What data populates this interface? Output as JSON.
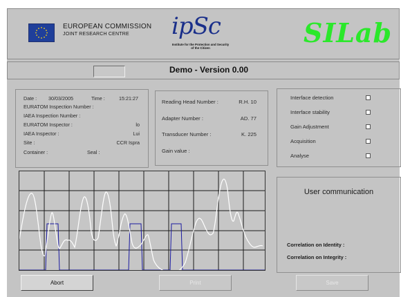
{
  "header": {
    "org_line1": "EUROPEAN COMMISSION",
    "org_line2": "JOINT RESEARCH CENTRE",
    "ipsc_logo": "ipSc",
    "ipsc_subtitle": "Institute for the Protection and Security of the Citizen",
    "app_logo": "SILab"
  },
  "titlebar": {
    "title": "Demo - Version 0.00",
    "field_value": ""
  },
  "inspection": {
    "date_label": "Date :",
    "date_value": "30/03/2005",
    "time_label": "Time :",
    "time_value": "15:21:27",
    "euratom_number_label": "EURATOM Inspection Number :",
    "iaea_number_label": "IAEA Inspection Number :",
    "euratom_inspector_label": "EURATOM Inspector :",
    "euratom_inspector_value": "lo",
    "iaea_inspector_label": "IAEA Inspector :",
    "iaea_inspector_value": "Lui",
    "site_label": "Site :",
    "site_value": "CCR Ispra",
    "container_label": "Container :",
    "seal_label": "Seal :"
  },
  "hardware": {
    "reading_head_label": "Reading Head Number :",
    "reading_head_value": "R.H. 10",
    "adapter_label": "Adapter Number :",
    "adapter_value": "AD. 77",
    "transducer_label": "Transducer Number :",
    "transducer_value": "K. 225",
    "gain_label": "Gain value :"
  },
  "status_checks": [
    {
      "label": "Interface detection",
      "checked": false
    },
    {
      "label": "Interface stability",
      "checked": false
    },
    {
      "label": "Gain Adjustment",
      "checked": false
    },
    {
      "label": "Acquisition",
      "checked": false
    },
    {
      "label": "Analyse",
      "checked": false
    }
  ],
  "user_communication": {
    "title": "User communication",
    "correlation_identity_label": "Correlation on Identity :",
    "correlation_integrity_label": "Correlation on Integrity :"
  },
  "buttons": {
    "abort": "Abort",
    "print": "Print",
    "save": "Save"
  },
  "colors": {
    "background": "#c4c4c4",
    "app_logo": "#2be82b",
    "signal": "#ffffff",
    "gate": "#1a1aa0"
  }
}
